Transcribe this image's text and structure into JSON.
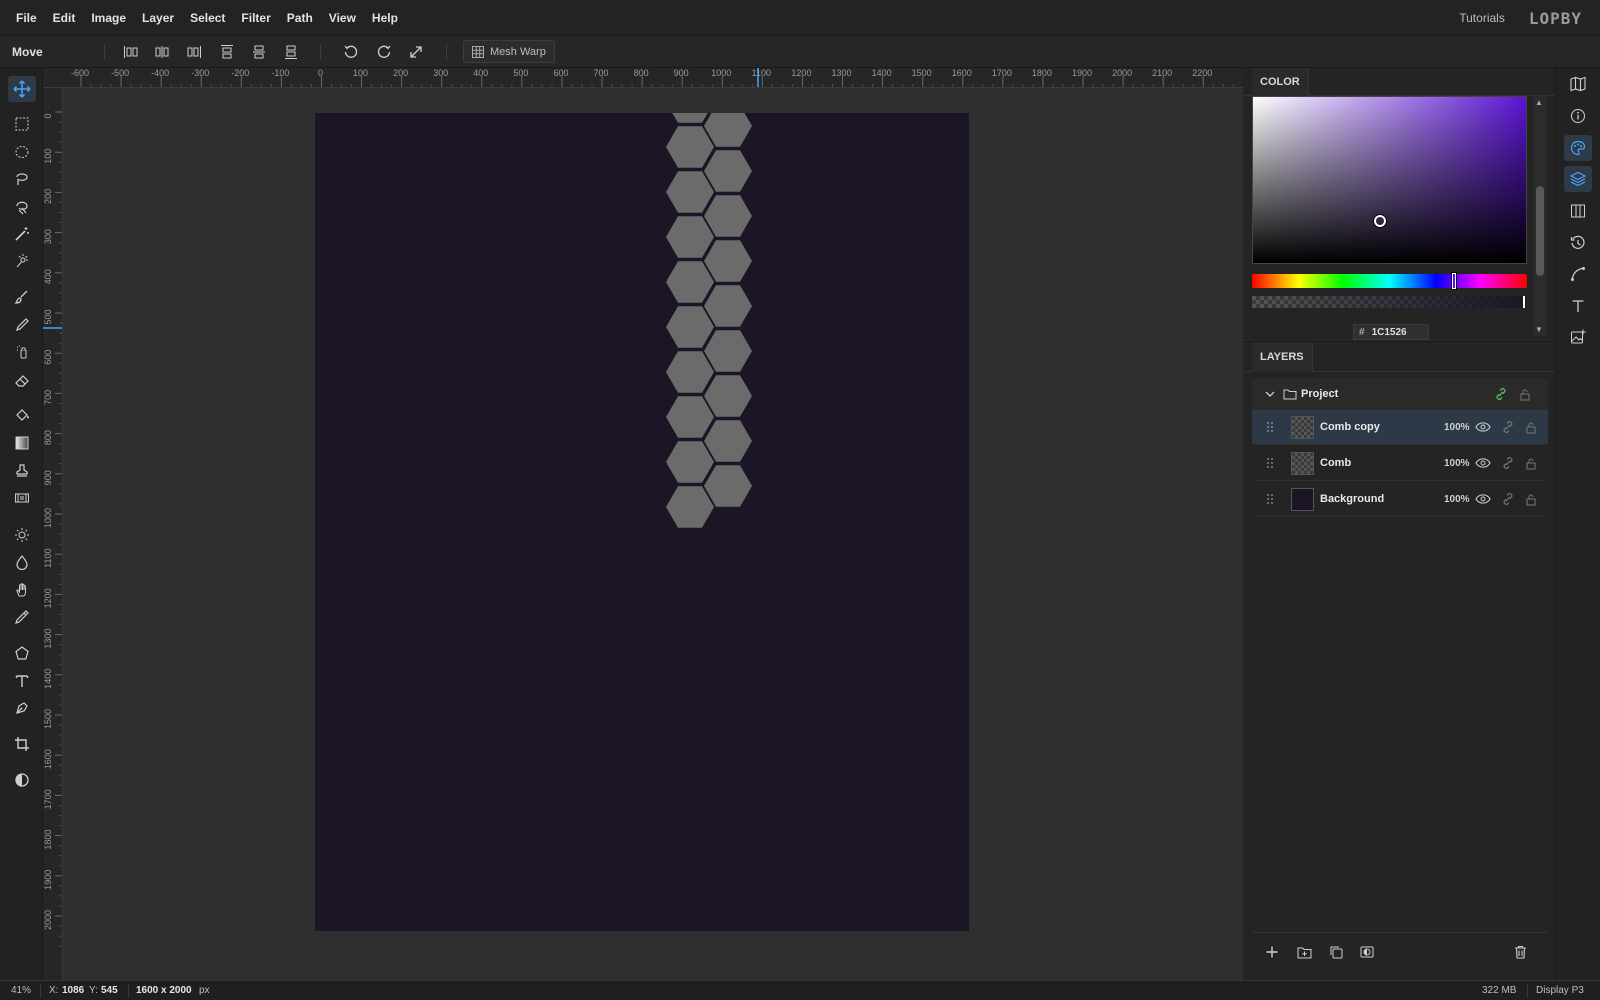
{
  "menubar": {
    "items": [
      "File",
      "Edit",
      "Image",
      "Layer",
      "Select",
      "Filter",
      "Path",
      "View",
      "Help"
    ],
    "tutorials": "Tutorials",
    "logo": "LOPBY"
  },
  "options_bar": {
    "tool_name": "Move",
    "mesh_warp_label": "Mesh Warp"
  },
  "rulers": {
    "top": [
      "-600",
      "-500",
      "-400",
      "-300",
      "-200",
      "-100",
      "0",
      "100",
      "200",
      "300",
      "400",
      "500",
      "600",
      "700",
      "800",
      "900",
      "1000",
      "1100",
      "1200",
      "1300",
      "1400",
      "1500",
      "1600",
      "1700",
      "1800",
      "1900",
      "2000",
      "2100",
      "2200"
    ],
    "left": [
      "0",
      "100",
      "200",
      "300",
      "400",
      "500",
      "600",
      "700",
      "800",
      "900",
      "1000",
      "1100",
      "1200",
      "1300",
      "1400",
      "1500",
      "1600",
      "1700",
      "1800",
      "1900",
      "2000"
    ]
  },
  "canvas": {
    "document_color": "#1c1526",
    "hexagon_color": "#6b6b6b"
  },
  "color_panel": {
    "title": "COLOR",
    "hex_prefix": "#",
    "hex_value": "1C1526"
  },
  "layers_panel": {
    "title": "LAYERS",
    "group_name": "Project",
    "layers": [
      {
        "name": "Comb copy",
        "opacity": "100%",
        "selected": true
      },
      {
        "name": "Comb",
        "opacity": "100%",
        "selected": false
      },
      {
        "name": "Background",
        "opacity": "100%",
        "selected": false
      }
    ]
  },
  "status": {
    "zoom": "41%",
    "x_label": "X:",
    "x_value": "1086",
    "y_label": "Y:",
    "y_value": "545",
    "doc_size": "1600 x 2000",
    "doc_unit": "px",
    "memory": "322 MB",
    "color_profile": "Display P3"
  },
  "colors": {
    "accent": "#4aa3ff",
    "selected_row": "#2d3947",
    "active_tool_bg": "#2f3a47",
    "link_green": "#4cc15a"
  }
}
